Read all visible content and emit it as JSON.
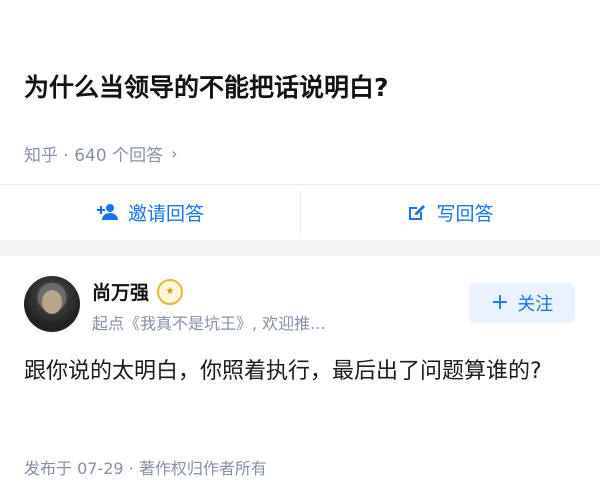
{
  "question": {
    "title": "为什么当领导的不能把话说明白?",
    "meta": "知乎 · 640 个回答",
    "chevron": "›"
  },
  "actions": {
    "invite_label": "邀请回答",
    "write_label": "写回答"
  },
  "author": {
    "name": "尚万强",
    "subtitle": "起点《我真不是坑王》, 欢迎推...",
    "follow_label": "关注",
    "follow_plus": "+"
  },
  "answer": {
    "text": "跟你说的太明白，你照着执行，最后出了问题算谁的?",
    "footer": "发布于 07-29 · 著作权归作者所有"
  },
  "colors": {
    "accent": "#1772f6",
    "muted": "#8590a6",
    "divider": "#ececec",
    "follow_bg": "#eaf2ff"
  }
}
